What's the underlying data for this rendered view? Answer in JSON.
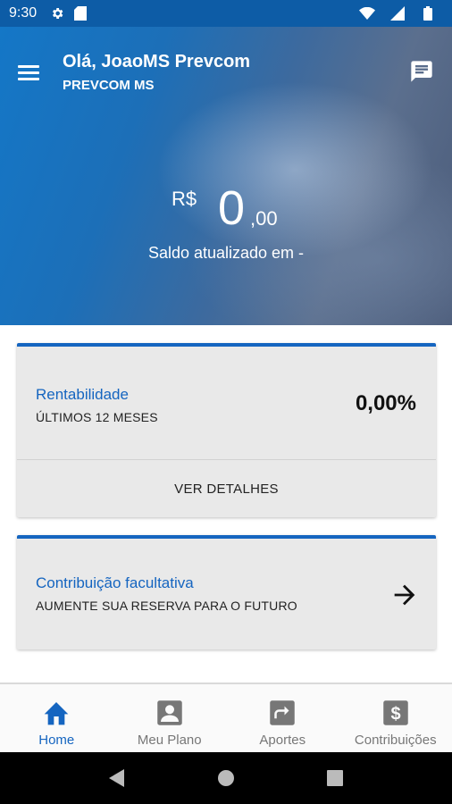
{
  "status_bar": {
    "time": "9:30",
    "icons": [
      "gear-icon",
      "sd-card-icon",
      "wifi-icon",
      "signal-icon",
      "battery-icon"
    ]
  },
  "header": {
    "greeting": "Olá, JoaoMS Prevcom",
    "organization": "PREVCOM MS",
    "icons": [
      "menu-icon",
      "chat-icon"
    ]
  },
  "balance": {
    "currency": "R$",
    "amount_integer": "0",
    "amount_decimal": ",00",
    "updated_text": "Saldo atualizado em -"
  },
  "cards": {
    "rentabilidade": {
      "title": "Rentabilidade",
      "subtitle": "ÚLTIMOS 12 MESES",
      "value": "0,00%",
      "action_label": "VER DETALHES"
    },
    "contribuicao": {
      "title": "Contribuição facultativa",
      "subtitle": "AUMENTE SUA RESERVA PARA O FUTURO",
      "icon": "arrow-right-icon"
    }
  },
  "bottom_nav": {
    "items": [
      {
        "label": "Home",
        "icon": "home-icon",
        "active": true
      },
      {
        "label": "Meu Plano",
        "icon": "person-card-icon",
        "active": false
      },
      {
        "label": "Aportes",
        "icon": "share-arrow-icon",
        "active": false
      },
      {
        "label": "Contribuições",
        "icon": "dollar-icon",
        "active": false
      }
    ]
  },
  "colors": {
    "primary": "#1565c0",
    "status_bar": "#0d5ca6",
    "card_bg": "#e9e9e9",
    "inactive_nav": "#777777"
  }
}
